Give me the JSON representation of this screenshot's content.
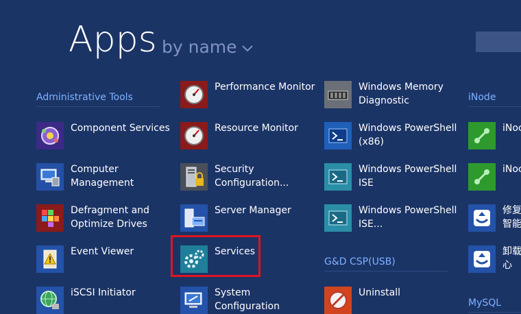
{
  "header": {
    "title": "Apps",
    "sort_label": "by name"
  },
  "groups": {
    "admin_tools": "Administrative Tools",
    "gd_csp": "G&D CSP(USB)",
    "inode": "iNode",
    "mysql": "MySQL"
  },
  "apps": {
    "component_services": "Component Services",
    "computer_management": "Computer Management",
    "defragment": "Defragment and Optimize Drives",
    "event_viewer": "Event Viewer",
    "iscsi": "iSCSI Initiator",
    "performance_monitor": "Performance Monitor",
    "resource_monitor": "Resource Monitor",
    "security_config": "Security Configuration...",
    "server_manager": "Server Manager",
    "services": "Services",
    "system_config": "System Configuration",
    "memory_diagnostic": "Windows Memory Diagnostic",
    "powershell_x86": "Windows PowerShell (x86)",
    "powershell_ise": "Windows PowerShell ISE",
    "powershell_ise_x86": "Windows PowerShell ISE...",
    "uninstall": "Uninstall",
    "inode_1": "iNoc",
    "inode_2": "iNoc",
    "repair": "修复智能",
    "uninstall_cn": "卸载心"
  },
  "colors": {
    "background": "#1b3466",
    "group_header": "#7fb2ff",
    "selection_border": "#e0141f"
  }
}
